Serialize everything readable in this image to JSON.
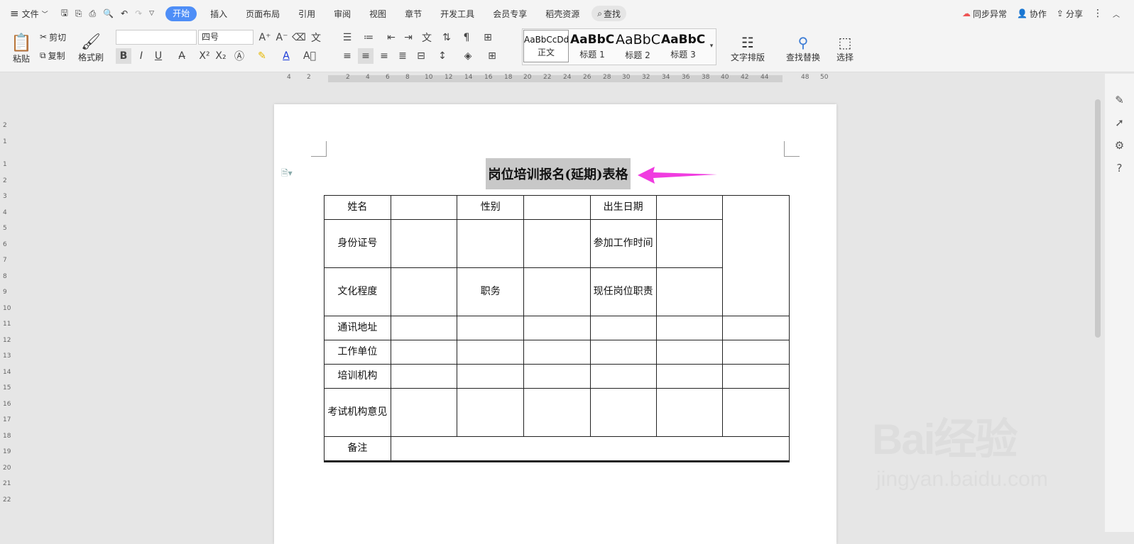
{
  "menubar": {
    "file": "文件",
    "tabs": [
      "开始",
      "插入",
      "页面布局",
      "引用",
      "审阅",
      "视图",
      "章节",
      "开发工具",
      "会员专享",
      "稻壳资源"
    ],
    "search": "查找",
    "sync": "同步异常",
    "collab": "协作",
    "share": "分享"
  },
  "ribbon": {
    "paste": "粘贴",
    "cut": "剪切",
    "copy": "复制",
    "format_painter": "格式刷",
    "font_size": "四号",
    "styles": [
      {
        "preview": "AaBbCcDd",
        "name": "正文"
      },
      {
        "preview": "AaBbC",
        "name": "标题 1"
      },
      {
        "preview": "AaBbC",
        "name": "标题 2"
      },
      {
        "preview": "AaBbC",
        "name": "标题 3"
      }
    ],
    "text_layout": "文字排版",
    "find_replace": "查找替换",
    "select": "选择"
  },
  "ruler": {
    "top": [
      "4",
      "2",
      "2",
      "4",
      "6",
      "8",
      "10",
      "12",
      "14",
      "16",
      "18",
      "20",
      "22",
      "24",
      "26",
      "28",
      "30",
      "32",
      "34",
      "36",
      "38",
      "40",
      "42",
      "44",
      "48",
      "50"
    ],
    "left": [
      "2",
      "1",
      "1",
      "2",
      "3",
      "4",
      "5",
      "6",
      "7",
      "8",
      "9",
      "10",
      "11",
      "12",
      "13",
      "14",
      "15",
      "16",
      "17",
      "18",
      "19",
      "20",
      "21",
      "22"
    ]
  },
  "document": {
    "title": "岗位培训报名(延期)表格",
    "table": {
      "name": "姓名",
      "gender": "性别",
      "birth": "出生日期",
      "id": "身份证号",
      "work_time": "参加工作时间",
      "edu": "文化程度",
      "post": "职务",
      "duty": "现任岗位职责",
      "addr": "通讯地址",
      "unit": "工作单位",
      "org": "培训机构",
      "exam": "考试机构意见",
      "remark": "备注"
    }
  },
  "watermark": {
    "main": "Bai经验",
    "sub": "jingyan.baidu.com"
  },
  "colors": {
    "accent": "#4e8ef7",
    "arrow": "#f03ce0",
    "highlight": "#c8c8c8"
  }
}
